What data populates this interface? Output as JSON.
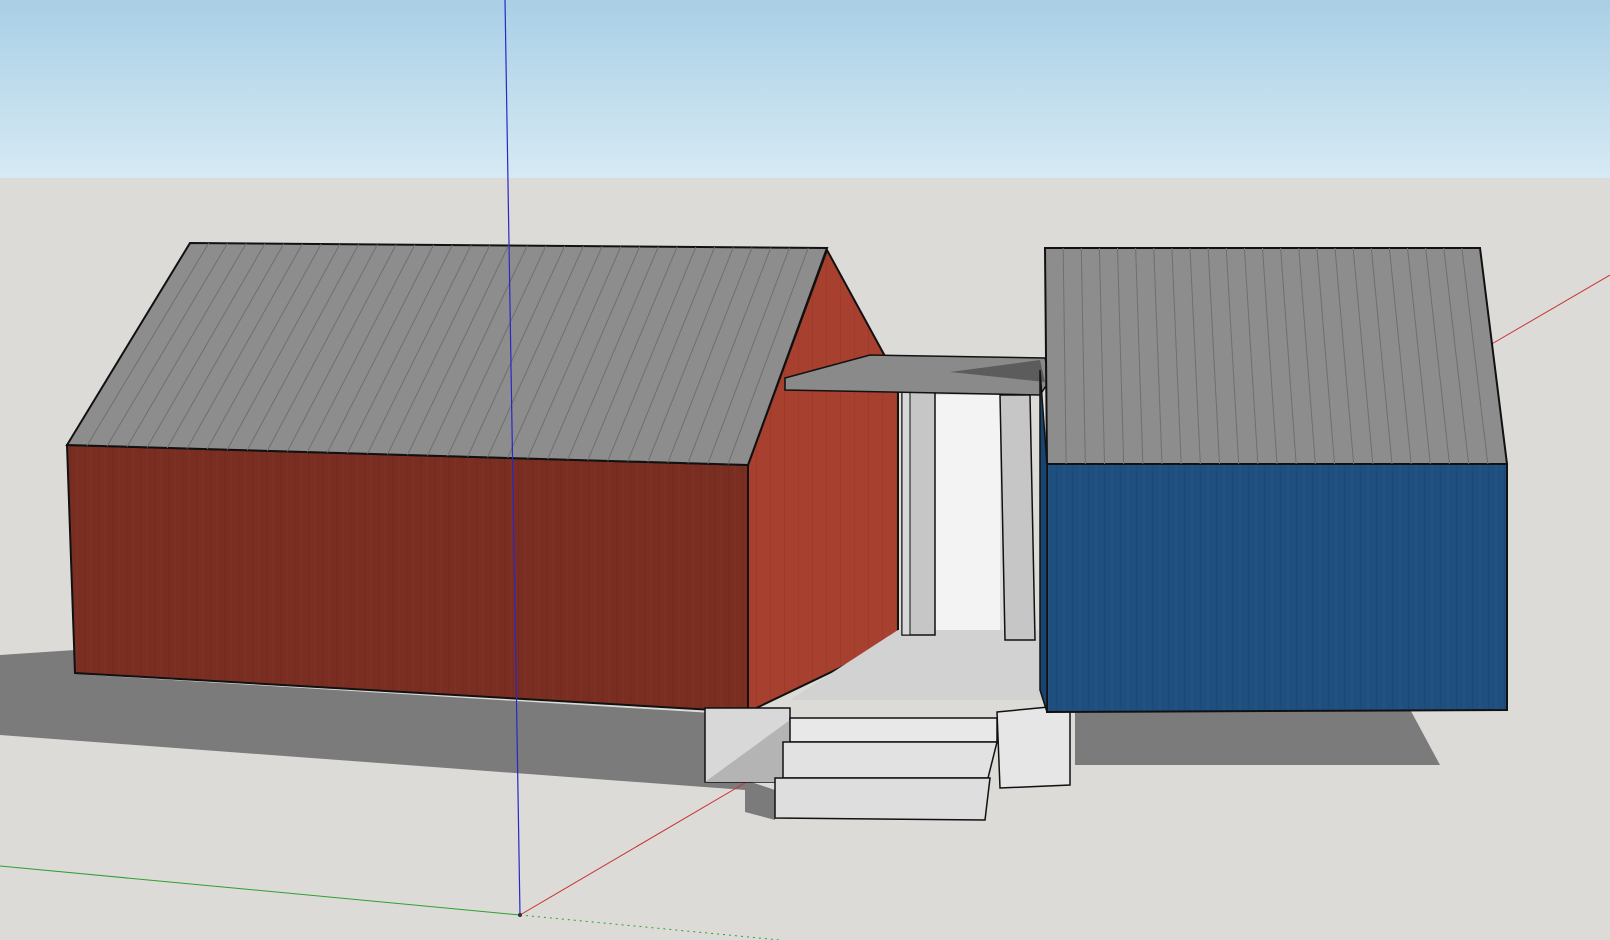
{
  "viewport": {
    "colors": {
      "sky_top": "#a9cfe6",
      "sky_bottom": "#d6eaf4",
      "ground": "#dcdbd8",
      "shadow": "#7b7b7b",
      "roof": "#8d8d8d",
      "roof_seam": "#6f6f6f",
      "red_siding_front": "#7a2e22",
      "red_siding_side": "#a8402f",
      "blue_siding": "#1f4f7f",
      "porch_floor": "#d0d0d0",
      "porch_column": "#c8c8c8",
      "steps": "#e2e2e2",
      "axis_red": "#c83232",
      "axis_green": "#2fa02f",
      "axis_blue": "#2828c8"
    }
  },
  "scene": {
    "ground_plane": "ground",
    "sky": "sky-gradient",
    "red_building": "red-gable-building",
    "blue_building": "blue-building",
    "porch": "covered-porch",
    "steps": "entry-steps",
    "axes": [
      "red-axis",
      "green-axis",
      "blue-axis"
    ]
  }
}
